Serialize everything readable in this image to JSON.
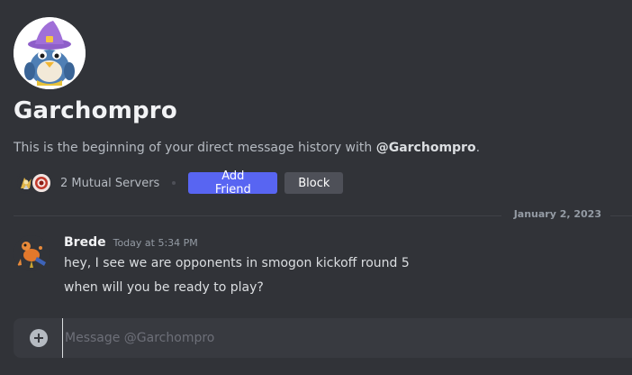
{
  "profile": {
    "name": "Garchompro",
    "intro_text": "This is the beginning of your direct message history with ",
    "intro_handle": "@Garchompro",
    "intro_end": ".",
    "avatar_icon": "wizard-bird-avatar-icon"
  },
  "mutual": {
    "label": "2 Mutual Servers",
    "server_icons": [
      "gold-character-server-icon",
      "red-emblem-server-icon"
    ]
  },
  "actions": {
    "add_friend": "Add Friend",
    "block": "Block"
  },
  "divider": {
    "date": "January 2, 2023"
  },
  "messages": [
    {
      "author": "Brede",
      "timestamp": "Today at 5:34 PM",
      "avatar_icon": "orange-creature-avatar-icon",
      "lines": [
        "hey, I see we are opponents in smogon kickoff round 5",
        "when will you be ready to play?"
      ]
    }
  ],
  "composer": {
    "placeholder": "Message @Garchompro",
    "attach_icon": "plus-circle-icon"
  },
  "colors": {
    "background": "#313338",
    "brand": "#5865f2",
    "secondary_button": "#4e5058",
    "composer": "#383a40"
  }
}
